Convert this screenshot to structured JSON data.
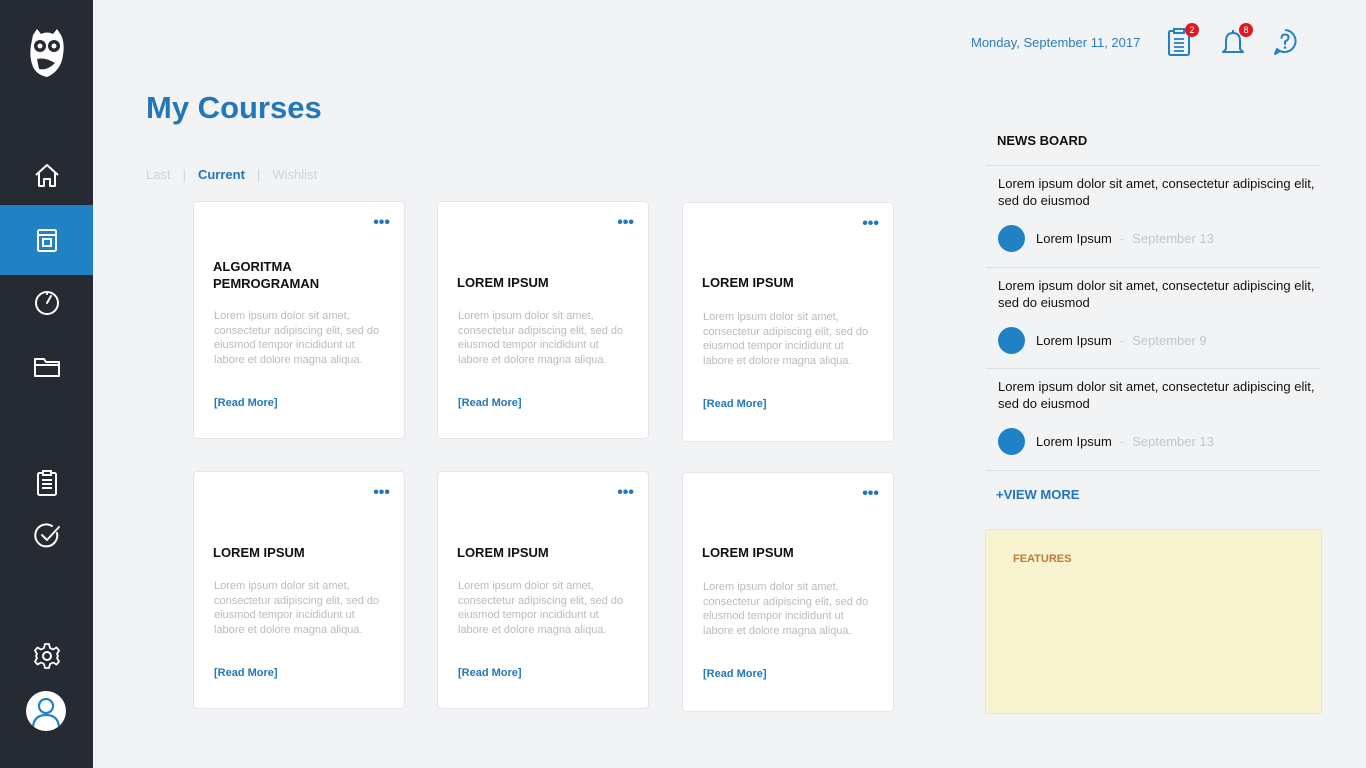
{
  "header": {
    "date": "Monday, September 11, 2017",
    "tasks_badge": "2",
    "notifications_badge": "8"
  },
  "page": {
    "title": "My Courses",
    "tabs": [
      "Last",
      "Current",
      "Wishlist"
    ],
    "tab_separator": "|"
  },
  "courses": [
    {
      "title": "ALGORITMA PEMROGRAMAN",
      "desc": "Lorem ipsum dolor sit amet, consectetur adipiscing elit, sed do eiusmod tempor incididunt ut labore et dolore magna aliqua.",
      "read_more": "[Read More]"
    },
    {
      "title": "LOREM IPSUM",
      "desc": "Lorem ipsum dolor sit amet, consectetur adipiscing elit, sed do eiusmod tempor incididunt ut labore et dolore magna aliqua.",
      "read_more": "[Read More]"
    },
    {
      "title": "LOREM IPSUM",
      "desc": "Lorem ipsum dolor sit amet, consectetur adipiscing elit, sed do eiusmod tempor incididunt ut labore et dolore magna aliqua.",
      "read_more": "[Read More]"
    },
    {
      "title": "LOREM IPSUM",
      "desc": "Lorem ipsum dolor sit amet, consectetur adipiscing elit, sed do eiusmod tempor incididunt ut labore et dolore magna aliqua.",
      "read_more": "[Read More]"
    },
    {
      "title": "LOREM IPSUM",
      "desc": "Lorem ipsum dolor sit amet, consectetur adipiscing elit, sed do eiusmod tempor incididunt ut labore et dolore magna aliqua.",
      "read_more": "[Read More]"
    },
    {
      "title": "LOREM IPSUM",
      "desc": "Lorem ipsum dolor sit amet, consectetur adipiscing elit, sed do eiusmod tempor incididunt ut labore et dolore magna aliqua.",
      "read_more": "[Read More]"
    }
  ],
  "card_menu_glyph": "•••",
  "news": {
    "heading": "NEWS BOARD",
    "items": [
      {
        "text": "Lorem ipsum dolor sit amet, consectetur adipiscing elit, sed do eiusmod",
        "author": "Lorem Ipsum",
        "date": "September 13"
      },
      {
        "text": "Lorem ipsum dolor sit amet, consectetur adipiscing elit, sed do eiusmod",
        "author": "Lorem Ipsum",
        "date": "September 9"
      },
      {
        "text": "Lorem ipsum dolor sit amet, consectetur adipiscing elit, sed do eiusmod",
        "author": "Lorem Ipsum",
        "date": "September 13"
      }
    ],
    "dash": "-",
    "view_more": "+VIEW MORE"
  },
  "features": {
    "title": "FEATURES"
  },
  "colors": {
    "sidebar": "#262a33",
    "accent": "#2181c5",
    "badge": "#e0191f",
    "features_bg": "#f8f4d0"
  },
  "icons": [
    "owl-logo-icon",
    "home-icon",
    "book-icon",
    "clock-icon",
    "folder-icon",
    "clipboard-icon",
    "check-circle-icon",
    "gear-icon",
    "user-icon",
    "bell-icon",
    "help-icon"
  ]
}
